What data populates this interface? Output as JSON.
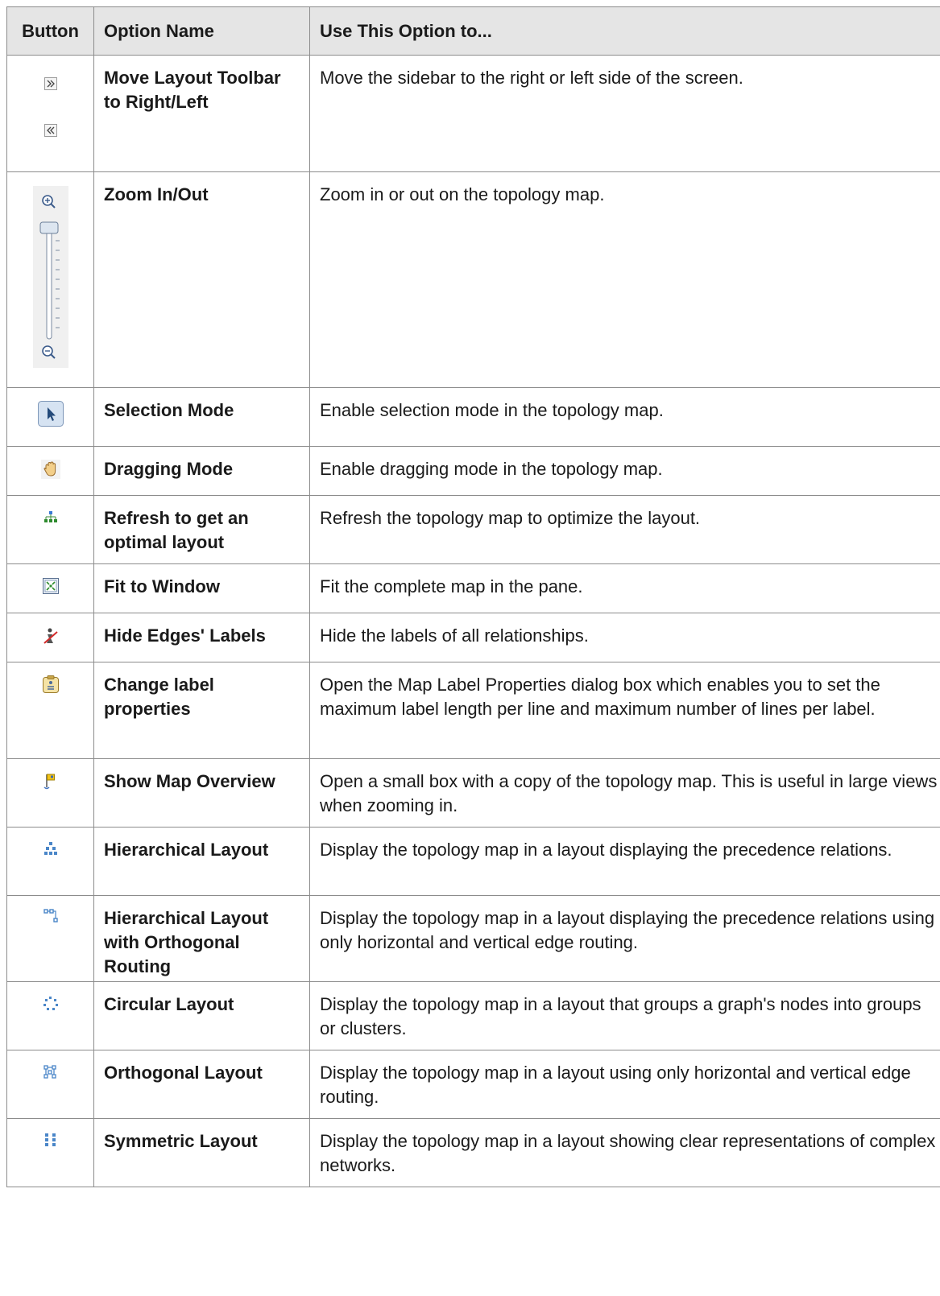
{
  "table": {
    "headers": [
      "Button",
      "Option Name",
      "Use This Option to..."
    ],
    "rows": [
      {
        "icons": [
          "chevron-right-icon",
          "chevron-left-icon"
        ],
        "name": "Move Layout Toolbar to Right/Left",
        "desc": "Move the sidebar to the right or left side of the screen."
      },
      {
        "icons": [
          "zoom-slider-icon"
        ],
        "name": "Zoom In/Out",
        "desc": "Zoom in or out on the topology map."
      },
      {
        "icons": [
          "pointer-arrow-icon"
        ],
        "name": "Selection Mode",
        "desc": "Enable selection mode in the topology map."
      },
      {
        "icons": [
          "hand-icon"
        ],
        "name": "Dragging Mode",
        "desc": "Enable dragging mode in the topology map."
      },
      {
        "icons": [
          "tree-layout-icon"
        ],
        "name": "Refresh to get an optimal layout",
        "desc": "Refresh the topology map to optimize the layout."
      },
      {
        "icons": [
          "fit-window-icon"
        ],
        "name": "Fit to Window",
        "desc": "Fit the complete map in the pane."
      },
      {
        "icons": [
          "hide-labels-icon"
        ],
        "name": "Hide Edges' Labels",
        "desc": "Hide the labels of all relationships."
      },
      {
        "icons": [
          "label-properties-icon"
        ],
        "name": "Change label properties",
        "desc": "Open the Map Label Properties dialog box which enables you to set the maximum label length per line and maximum number of lines per label."
      },
      {
        "icons": [
          "map-overview-flag-icon"
        ],
        "name": "Show Map Overview",
        "desc": "Open a small box with a copy of the topology map. This is useful in large views when zooming in."
      },
      {
        "icons": [
          "hierarchical-layout-icon"
        ],
        "name": "Hierarchical Layout",
        "desc": "Display the topology map in a layout displaying the precedence relations."
      },
      {
        "icons": [
          "orthogonal-routing-icon"
        ],
        "name": "Hierarchical Layout with Orthogonal Routing",
        "desc": "Display the topology map in a layout displaying the precedence relations using only horizontal and vertical edge routing."
      },
      {
        "icons": [
          "circular-layout-icon"
        ],
        "name": "Circular Layout",
        "desc": "Display the topology map in a layout that groups a graph's nodes into groups or clusters."
      },
      {
        "icons": [
          "orthogonal-layout-icon"
        ],
        "name": "Orthogonal Layout",
        "desc": "Display the topology map in a layout using only horizontal and vertical edge routing."
      },
      {
        "icons": [
          "symmetric-layout-icon"
        ],
        "name": "Symmetric Layout",
        "desc": "Display the topology map in a layout showing clear representations of complex networks."
      }
    ]
  }
}
